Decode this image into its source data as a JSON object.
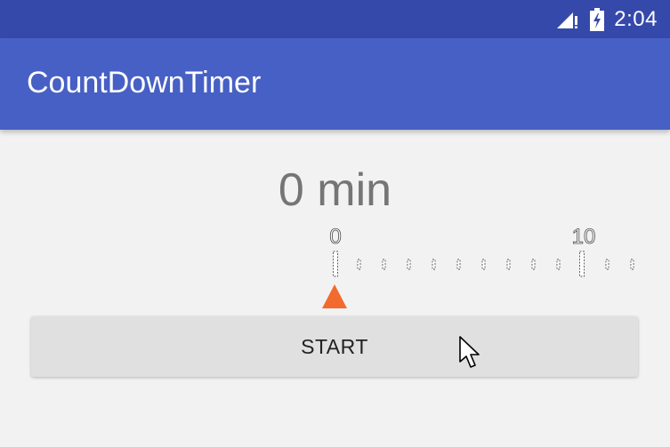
{
  "status_bar": {
    "time": "2:04",
    "icons": [
      "signal-icon",
      "battery-icon"
    ],
    "color": "#3549ab"
  },
  "app_bar": {
    "title": "CountDownTimer",
    "color": "#4760c5"
  },
  "timer": {
    "display": "0 min",
    "selected_minutes": 0
  },
  "ruler": {
    "labels": [
      "0",
      "10"
    ],
    "pointer_icon": "triangle-pointer-icon",
    "pointer_color": "#f26a2e"
  },
  "start_button": {
    "label": "START"
  },
  "cursor": {
    "icon": "mouse-pointer-icon"
  }
}
